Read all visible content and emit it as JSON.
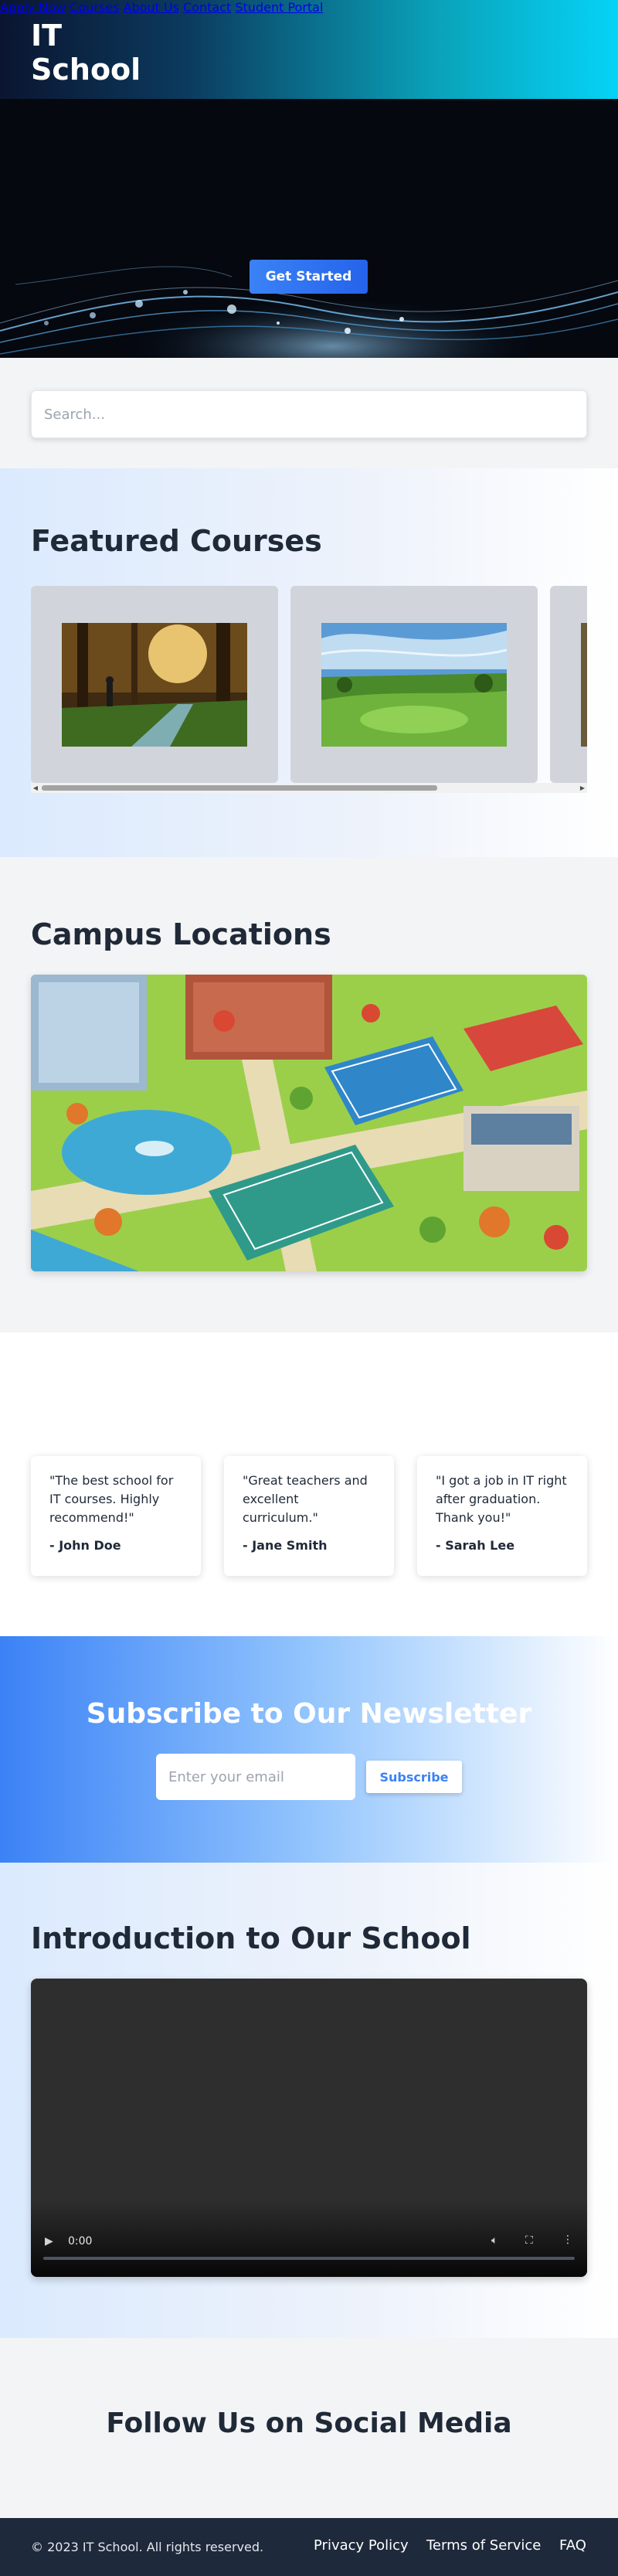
{
  "header": {
    "logo": "IT School",
    "nav": [
      "Apply Now",
      "Courses",
      "About Us",
      "Contact",
      "Student Portal"
    ]
  },
  "hero": {
    "cta_label": "Get Started"
  },
  "search": {
    "placeholder": "Search..."
  },
  "featured": {
    "title": "Featured Courses"
  },
  "campus": {
    "title": "Campus Locations"
  },
  "testimonials": [
    {
      "quote": "\"The best school for IT courses. Highly recommend!\"",
      "author": "- John Doe"
    },
    {
      "quote": "\"Great teachers and excellent curriculum.\"",
      "author": "- Jane Smith"
    },
    {
      "quote": "\"I got a job in IT right after graduation. Thank you!\"",
      "author": "- Sarah Lee"
    }
  ],
  "newsletter": {
    "title": "Subscribe to Our Newsletter",
    "email_placeholder": "Enter your email",
    "button_label": "Subscribe"
  },
  "intro": {
    "title": "Introduction to Our School",
    "video_time": "0:00"
  },
  "social": {
    "title": "Follow Us on Social Media"
  },
  "footer": {
    "copyright": "© 2023 IT School. All rights reserved.",
    "links": [
      "Privacy Policy",
      "Terms of Service",
      "FAQ"
    ]
  },
  "colors": {
    "accent": "#3b82f6",
    "footer_bg": "#1e293b"
  }
}
